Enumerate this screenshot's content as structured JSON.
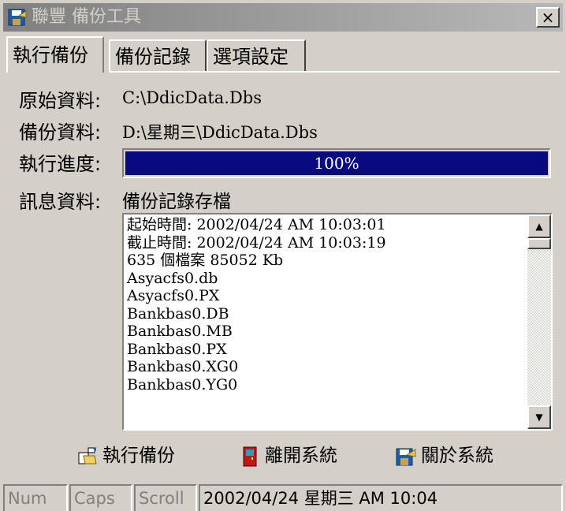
{
  "window": {
    "title": "聯豐 備份工具",
    "close_glyph": "×"
  },
  "tabs": [
    {
      "label": "執行備份",
      "active": true
    },
    {
      "label": "備份記錄",
      "active": false
    },
    {
      "label": "選項設定",
      "active": false
    }
  ],
  "fields": {
    "source_label": "原始資料:",
    "source_value": "C:\\DdicData.Dbs",
    "backup_label": "備份資料:",
    "backup_value": "D:\\星期三\\DdicData.Dbs",
    "progress_label": "執行進度:",
    "progress_percent": 100,
    "progress_text": "100%",
    "info_label": "訊息資料:",
    "info_value": "備份記錄存檔"
  },
  "log": {
    "lines": [
      "起始時間: 2002/04/24 AM 10:03:01",
      "截止時間: 2002/04/24 AM 10:03:19",
      "635 個檔案 85052 Kb",
      "Asyacfs0.db",
      "Asyacfs0.PX",
      "Bankbas0.DB",
      "Bankbas0.MB",
      "Bankbas0.PX",
      "Bankbas0.XG0",
      "Bankbas0.YG0"
    ],
    "scroll_up": "▲",
    "scroll_down": "▼"
  },
  "actions": {
    "run_backup": "執行備份",
    "exit_system": "離開系統",
    "about_system": "關於系統"
  },
  "statusbar": {
    "num": "Num",
    "caps": "Caps",
    "scroll": "Scroll",
    "datetime": "2002/04/24 星期三 AM 10:04"
  },
  "colors": {
    "progress_fill": "#0a0a80",
    "face": "#d4d0c8"
  }
}
